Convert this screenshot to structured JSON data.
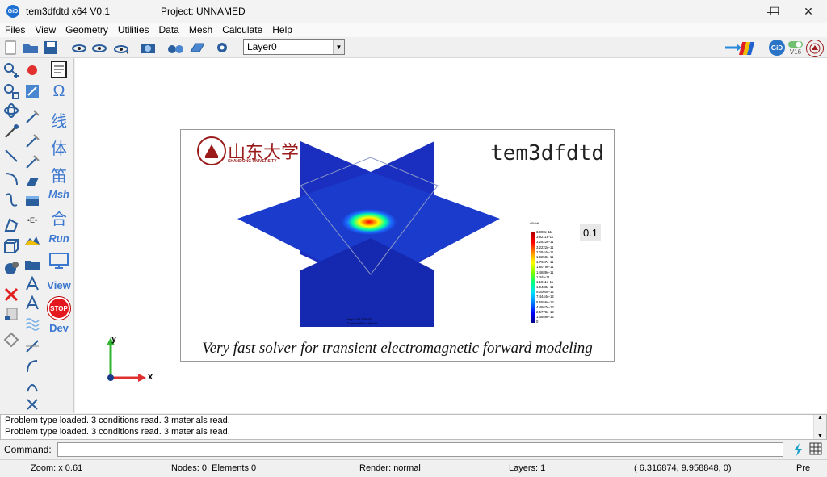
{
  "window": {
    "app_title": "tem3dfdtd x64 V0.1",
    "project_title": "Project: UNNAMED",
    "app_icon_text": "GiD",
    "controls": [
      "minimize",
      "maximize",
      "close"
    ]
  },
  "menu": [
    "Files",
    "View",
    "Geometry",
    "Utilities",
    "Data",
    "Mesh",
    "Calculate",
    "Help"
  ],
  "toolbar": {
    "layer_value": "Layer0",
    "gid_badge": "GiD",
    "version": "V16"
  },
  "left_panel": {
    "cjk_buttons": [
      "线",
      "体",
      "笛"
    ],
    "msh_label": "Msh",
    "he_label": "合",
    "run_label": "Run",
    "view_label": "View",
    "stop_label": "STOP",
    "dev_label": "Dev"
  },
  "splash": {
    "university_name": "山东大学",
    "university_sub": "SHANDONG UNIVERSITY",
    "app_name": "tem3dfdtd",
    "tagline": "Very fast solver for transient electromagnetic forward modeling",
    "time_value": "0.1",
    "legend_title": "dBz/dt",
    "legend_ticks": [
      "3.998e-11",
      "3.9211e-11",
      "3.2822e-11",
      "3.2222e-11",
      "2.2844e-11",
      "1.9258e-11",
      "1.7667e-11",
      "1.8079e-11",
      "1.4689e-11",
      "1.3da-11",
      "1.1511e-11",
      "1.0433e-11",
      "9.0000e-12",
      "7.4444e-12",
      "5.5556e-12",
      "4.4667e-12",
      "2.5778e-12",
      "1.4889e-12",
      "0"
    ],
    "step_info": [
      "step 0.01279833",
      "Contour Fill of dBz/dt"
    ]
  },
  "axes": {
    "x": "x",
    "y": "y"
  },
  "messages": [
    "Problem type loaded. 3 conditions read. 3 materials read.",
    "Problem type loaded. 3 conditions read. 3 materials read."
  ],
  "command": {
    "label": "Command:",
    "value": ""
  },
  "status": {
    "zoom": "Zoom: x 0.61",
    "nodes": "Nodes: 0, Elements 0",
    "render": "Render: normal",
    "layers": "Layers: 1",
    "coords": "( 6.316874,  9.958848,  0)",
    "mode": "Pre"
  },
  "colors": {
    "accent": "#3c78d0",
    "stop": "#e4161e",
    "university": "#9b1b1b"
  }
}
